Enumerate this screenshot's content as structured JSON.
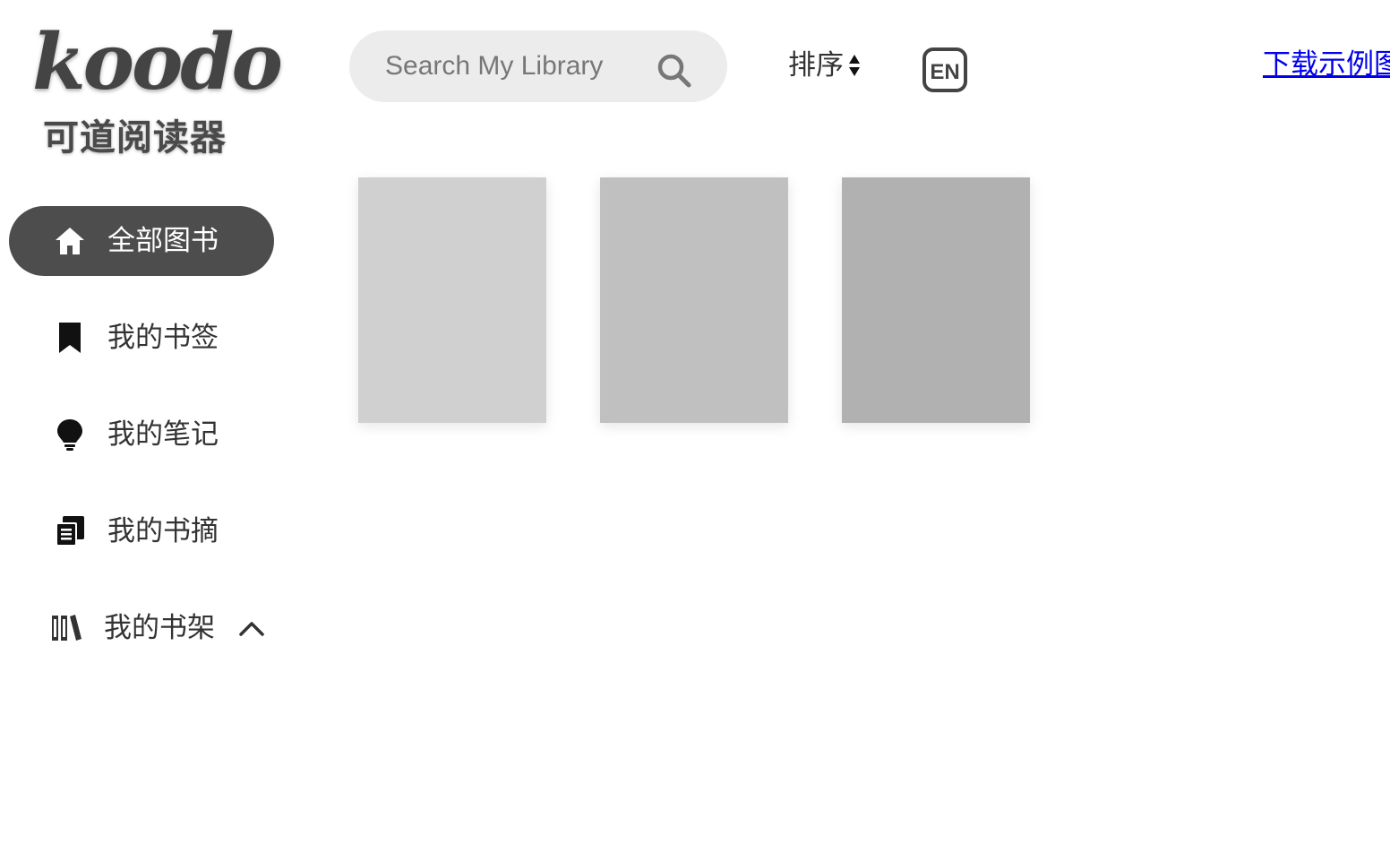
{
  "logo": {
    "wordmark": "koodo",
    "subtitle": "可道阅读器"
  },
  "sidebar": {
    "items": [
      {
        "label": "全部图书",
        "icon": "home-icon",
        "active": true
      },
      {
        "label": "我的书签",
        "icon": "bookmark-icon",
        "active": false
      },
      {
        "label": "我的笔记",
        "icon": "lightbulb-icon",
        "active": false
      },
      {
        "label": "我的书摘",
        "icon": "digest-icon",
        "active": false
      },
      {
        "label": "我的书架",
        "icon": "bookshelf-icon",
        "active": false,
        "expand_icon": "chevron-up-icon"
      }
    ]
  },
  "header": {
    "search": {
      "placeholder": "Search My Library",
      "value": "",
      "icon": "search-icon"
    },
    "sort_label": "排序",
    "sort_icon": "sort-arrows-icon",
    "language_button": "EN",
    "download_link": "下载示例图"
  },
  "library": {
    "books": [
      {
        "cover_color": "#d0d0d0"
      },
      {
        "cover_color": "#c0c0c0"
      },
      {
        "cover_color": "#b1b1b1"
      }
    ]
  },
  "colors": {
    "active_nav_bg": "#4d4d4d",
    "search_bg": "#ececec",
    "link": "#0000ee"
  }
}
